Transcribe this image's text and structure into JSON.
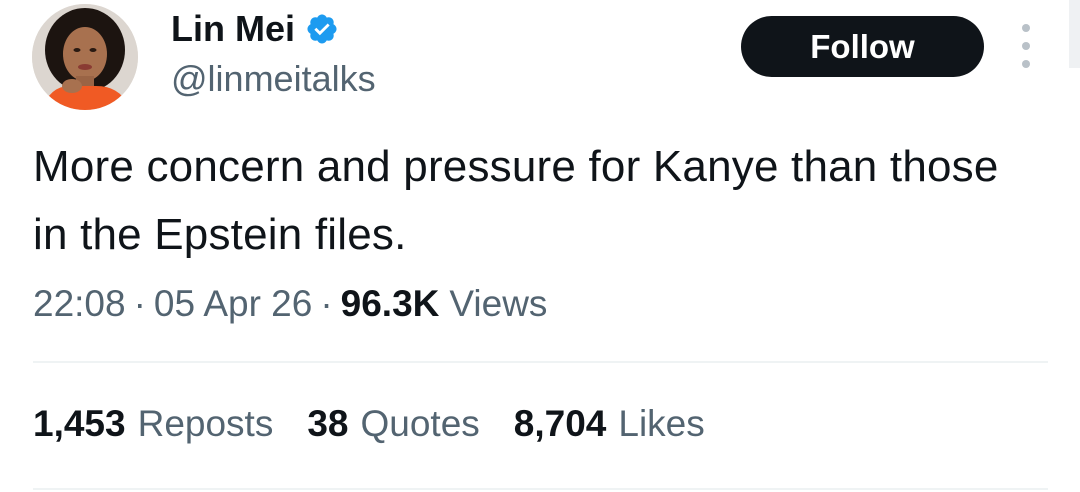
{
  "author": {
    "display_name": "Lin Mei",
    "handle": "@linmeitalks",
    "verified": true
  },
  "follow_label": "Follow",
  "tweet_text": "More concern and pressure for Kanye than those in the Epstein files.",
  "meta": {
    "time": "22:08",
    "separator": "·",
    "date": "05 Apr 26",
    "views_count": "96.3K",
    "views_label": "Views"
  },
  "stats": {
    "reposts_count": "1,453",
    "reposts_label": "Reposts",
    "quotes_count": "38",
    "quotes_label": "Quotes",
    "likes_count": "8,704",
    "likes_label": "Likes"
  },
  "icons": {
    "verified": "verified-badge-icon",
    "more": "more-options-icon"
  },
  "colors": {
    "text_primary": "#0f1419",
    "text_secondary": "#536471",
    "verified_blue": "#1d9bf0",
    "follow_bg": "#0f1419",
    "follow_text": "#ffffff",
    "divider": "#eff3f4"
  }
}
